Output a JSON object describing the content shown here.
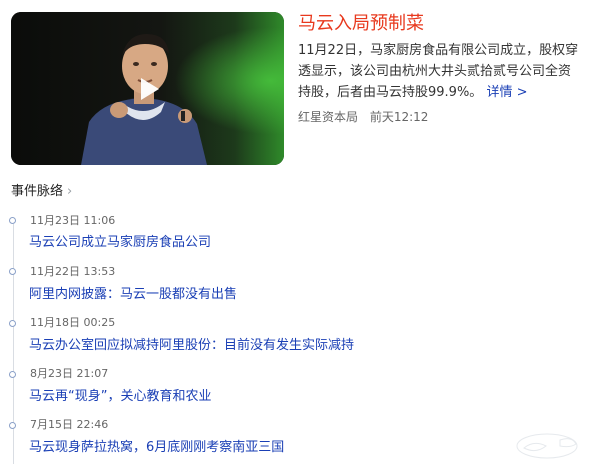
{
  "news": {
    "title": "马云入局预制菜",
    "summary": "11月22日，马家厨房食品有限公司成立，股权穿透显示，该公司由杭州大井头贰拾贰号公司全资持股，后者由马云持股99.9%。",
    "more_label": "详情 >",
    "source": "红星资本局",
    "time": "前天12:12"
  },
  "timeline": {
    "heading": "事件脉络",
    "events": [
      {
        "time": "11月23日 11:06",
        "title": "马云公司成立马家厨房食品公司"
      },
      {
        "time": "11月22日 13:53",
        "title": "阿里内网披露：马云一股都没有出售"
      },
      {
        "time": "11月18日 00:25",
        "title": "马云办公室回应拟减持阿里股份：目前没有发生实际减持"
      },
      {
        "time": "8月23日 21:07",
        "title": "马云再“现身”，关心教育和农业"
      },
      {
        "time": "7月15日 22:46",
        "title": "马云现身萨拉热窝，6月底刚刚考察南亚三国"
      }
    ]
  }
}
